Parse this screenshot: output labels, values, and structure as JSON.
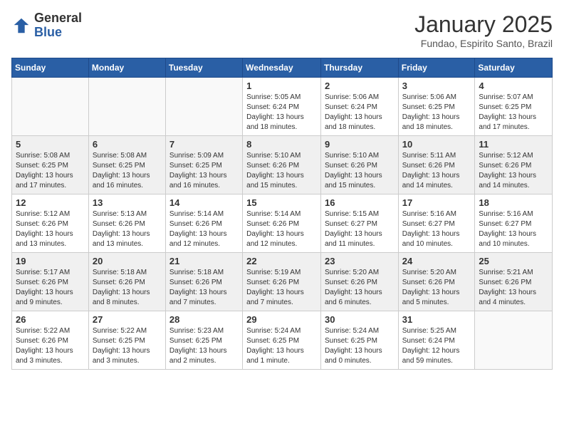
{
  "logo": {
    "general": "General",
    "blue": "Blue"
  },
  "header": {
    "month": "January 2025",
    "location": "Fundao, Espirito Santo, Brazil"
  },
  "days_of_week": [
    "Sunday",
    "Monday",
    "Tuesday",
    "Wednesday",
    "Thursday",
    "Friday",
    "Saturday"
  ],
  "weeks": [
    [
      {
        "day": "",
        "info": ""
      },
      {
        "day": "",
        "info": ""
      },
      {
        "day": "",
        "info": ""
      },
      {
        "day": "1",
        "info": "Sunrise: 5:05 AM\nSunset: 6:24 PM\nDaylight: 13 hours\nand 18 minutes."
      },
      {
        "day": "2",
        "info": "Sunrise: 5:06 AM\nSunset: 6:24 PM\nDaylight: 13 hours\nand 18 minutes."
      },
      {
        "day": "3",
        "info": "Sunrise: 5:06 AM\nSunset: 6:25 PM\nDaylight: 13 hours\nand 18 minutes."
      },
      {
        "day": "4",
        "info": "Sunrise: 5:07 AM\nSunset: 6:25 PM\nDaylight: 13 hours\nand 17 minutes."
      }
    ],
    [
      {
        "day": "5",
        "info": "Sunrise: 5:08 AM\nSunset: 6:25 PM\nDaylight: 13 hours\nand 17 minutes."
      },
      {
        "day": "6",
        "info": "Sunrise: 5:08 AM\nSunset: 6:25 PM\nDaylight: 13 hours\nand 16 minutes."
      },
      {
        "day": "7",
        "info": "Sunrise: 5:09 AM\nSunset: 6:25 PM\nDaylight: 13 hours\nand 16 minutes."
      },
      {
        "day": "8",
        "info": "Sunrise: 5:10 AM\nSunset: 6:26 PM\nDaylight: 13 hours\nand 15 minutes."
      },
      {
        "day": "9",
        "info": "Sunrise: 5:10 AM\nSunset: 6:26 PM\nDaylight: 13 hours\nand 15 minutes."
      },
      {
        "day": "10",
        "info": "Sunrise: 5:11 AM\nSunset: 6:26 PM\nDaylight: 13 hours\nand 14 minutes."
      },
      {
        "day": "11",
        "info": "Sunrise: 5:12 AM\nSunset: 6:26 PM\nDaylight: 13 hours\nand 14 minutes."
      }
    ],
    [
      {
        "day": "12",
        "info": "Sunrise: 5:12 AM\nSunset: 6:26 PM\nDaylight: 13 hours\nand 13 minutes."
      },
      {
        "day": "13",
        "info": "Sunrise: 5:13 AM\nSunset: 6:26 PM\nDaylight: 13 hours\nand 13 minutes."
      },
      {
        "day": "14",
        "info": "Sunrise: 5:14 AM\nSunset: 6:26 PM\nDaylight: 13 hours\nand 12 minutes."
      },
      {
        "day": "15",
        "info": "Sunrise: 5:14 AM\nSunset: 6:26 PM\nDaylight: 13 hours\nand 12 minutes."
      },
      {
        "day": "16",
        "info": "Sunrise: 5:15 AM\nSunset: 6:27 PM\nDaylight: 13 hours\nand 11 minutes."
      },
      {
        "day": "17",
        "info": "Sunrise: 5:16 AM\nSunset: 6:27 PM\nDaylight: 13 hours\nand 10 minutes."
      },
      {
        "day": "18",
        "info": "Sunrise: 5:16 AM\nSunset: 6:27 PM\nDaylight: 13 hours\nand 10 minutes."
      }
    ],
    [
      {
        "day": "19",
        "info": "Sunrise: 5:17 AM\nSunset: 6:26 PM\nDaylight: 13 hours\nand 9 minutes."
      },
      {
        "day": "20",
        "info": "Sunrise: 5:18 AM\nSunset: 6:26 PM\nDaylight: 13 hours\nand 8 minutes."
      },
      {
        "day": "21",
        "info": "Sunrise: 5:18 AM\nSunset: 6:26 PM\nDaylight: 13 hours\nand 7 minutes."
      },
      {
        "day": "22",
        "info": "Sunrise: 5:19 AM\nSunset: 6:26 PM\nDaylight: 13 hours\nand 7 minutes."
      },
      {
        "day": "23",
        "info": "Sunrise: 5:20 AM\nSunset: 6:26 PM\nDaylight: 13 hours\nand 6 minutes."
      },
      {
        "day": "24",
        "info": "Sunrise: 5:20 AM\nSunset: 6:26 PM\nDaylight: 13 hours\nand 5 minutes."
      },
      {
        "day": "25",
        "info": "Sunrise: 5:21 AM\nSunset: 6:26 PM\nDaylight: 13 hours\nand 4 minutes."
      }
    ],
    [
      {
        "day": "26",
        "info": "Sunrise: 5:22 AM\nSunset: 6:26 PM\nDaylight: 13 hours\nand 3 minutes."
      },
      {
        "day": "27",
        "info": "Sunrise: 5:22 AM\nSunset: 6:25 PM\nDaylight: 13 hours\nand 3 minutes."
      },
      {
        "day": "28",
        "info": "Sunrise: 5:23 AM\nSunset: 6:25 PM\nDaylight: 13 hours\nand 2 minutes."
      },
      {
        "day": "29",
        "info": "Sunrise: 5:24 AM\nSunset: 6:25 PM\nDaylight: 13 hours\nand 1 minute."
      },
      {
        "day": "30",
        "info": "Sunrise: 5:24 AM\nSunset: 6:25 PM\nDaylight: 13 hours\nand 0 minutes."
      },
      {
        "day": "31",
        "info": "Sunrise: 5:25 AM\nSunset: 6:24 PM\nDaylight: 12 hours\nand 59 minutes."
      },
      {
        "day": "",
        "info": ""
      }
    ]
  ]
}
